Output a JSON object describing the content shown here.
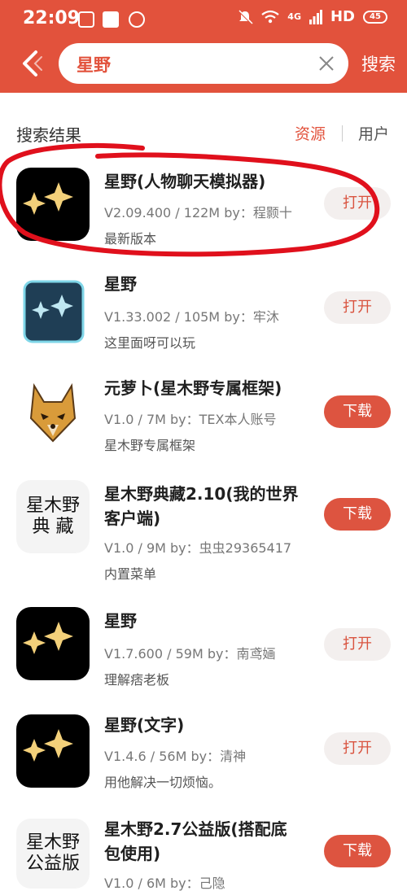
{
  "status_bar": {
    "time": "22:09",
    "network": "HD",
    "signal": "4G",
    "battery": "45"
  },
  "header": {
    "back_icon": "chevron-left-icon",
    "search_query": "星野",
    "clear_icon": "close-icon",
    "search_button": "搜索"
  },
  "results_header": {
    "title": "搜索结果",
    "tab_resources": "资源",
    "tab_users": "用户"
  },
  "colors": {
    "accent": "#e2523c",
    "annotation": "#e0101c"
  },
  "items": [
    {
      "icon": "sparkle-icon",
      "name_line1": "星野(人物聊天模拟器)",
      "name_line2": "",
      "meta": "V2.09.400 / 122M   by：程颢十",
      "desc": "最新版本",
      "action": "打开"
    },
    {
      "icon": "dark-square-sparkle-icon",
      "name_line1": "星野",
      "name_line2": "",
      "meta": "V1.33.002 / 105M   by：牢沐",
      "desc": "这里面呀可以玩",
      "action": "打开"
    },
    {
      "icon": "fox-icon",
      "name_line1": "元萝卜(星木野专属框架)",
      "name_line2": "",
      "meta": "V1.0 / 7M   by：TEX本人账号",
      "desc": "星木野专属框架",
      "action": "下载"
    },
    {
      "icon": "text-logo",
      "icon_text": "星木野\n典 藏",
      "name_line1": "星木野典藏2.10(我的世界",
      "name_line2": "客户端)",
      "meta": "V1.0 / 9M   by：虫虫29365417",
      "desc": "内置菜单",
      "action": "下载"
    },
    {
      "icon": "sparkle-icon",
      "name_line1": "星野",
      "name_line2": "",
      "meta": "V1.7.600 / 59M   by：南鸢婳",
      "desc": "理解痞老板",
      "action": "打开"
    },
    {
      "icon": "sparkle-icon",
      "name_line1": "星野(文字)",
      "name_line2": "",
      "meta": "V1.4.6 / 56M   by：清神",
      "desc": "用他解决一切烦恼。",
      "action": "打开"
    },
    {
      "icon": "text-logo",
      "icon_text": "星木野\n公益版",
      "name_line1": "星木野2.7公益版(搭配底",
      "name_line2": "包使用)",
      "meta": "V1.0 / 6M   by：己隐",
      "desc": "",
      "action": "下载"
    }
  ]
}
